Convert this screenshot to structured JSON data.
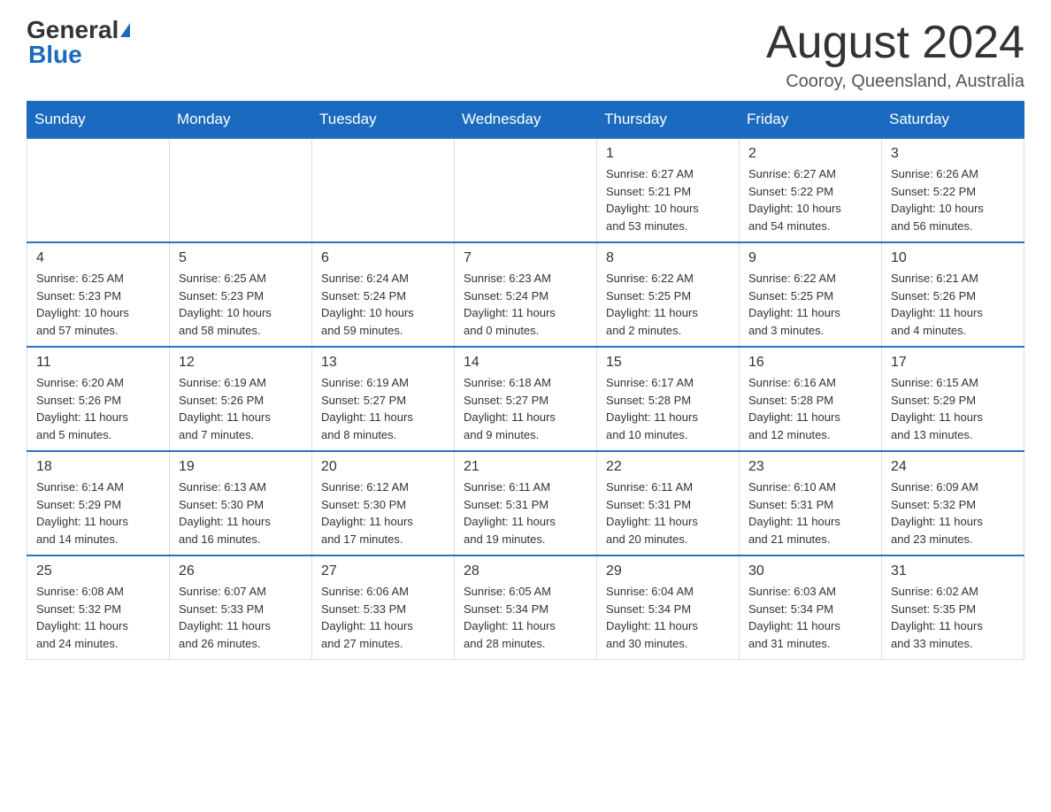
{
  "header": {
    "logo_general": "General",
    "logo_blue": "Blue",
    "month_title": "August 2024",
    "location": "Cooroy, Queensland, Australia"
  },
  "days_of_week": [
    "Sunday",
    "Monday",
    "Tuesday",
    "Wednesday",
    "Thursday",
    "Friday",
    "Saturday"
  ],
  "weeks": [
    [
      {
        "day": "",
        "info": ""
      },
      {
        "day": "",
        "info": ""
      },
      {
        "day": "",
        "info": ""
      },
      {
        "day": "",
        "info": ""
      },
      {
        "day": "1",
        "info": "Sunrise: 6:27 AM\nSunset: 5:21 PM\nDaylight: 10 hours\nand 53 minutes."
      },
      {
        "day": "2",
        "info": "Sunrise: 6:27 AM\nSunset: 5:22 PM\nDaylight: 10 hours\nand 54 minutes."
      },
      {
        "day": "3",
        "info": "Sunrise: 6:26 AM\nSunset: 5:22 PM\nDaylight: 10 hours\nand 56 minutes."
      }
    ],
    [
      {
        "day": "4",
        "info": "Sunrise: 6:25 AM\nSunset: 5:23 PM\nDaylight: 10 hours\nand 57 minutes."
      },
      {
        "day": "5",
        "info": "Sunrise: 6:25 AM\nSunset: 5:23 PM\nDaylight: 10 hours\nand 58 minutes."
      },
      {
        "day": "6",
        "info": "Sunrise: 6:24 AM\nSunset: 5:24 PM\nDaylight: 10 hours\nand 59 minutes."
      },
      {
        "day": "7",
        "info": "Sunrise: 6:23 AM\nSunset: 5:24 PM\nDaylight: 11 hours\nand 0 minutes."
      },
      {
        "day": "8",
        "info": "Sunrise: 6:22 AM\nSunset: 5:25 PM\nDaylight: 11 hours\nand 2 minutes."
      },
      {
        "day": "9",
        "info": "Sunrise: 6:22 AM\nSunset: 5:25 PM\nDaylight: 11 hours\nand 3 minutes."
      },
      {
        "day": "10",
        "info": "Sunrise: 6:21 AM\nSunset: 5:26 PM\nDaylight: 11 hours\nand 4 minutes."
      }
    ],
    [
      {
        "day": "11",
        "info": "Sunrise: 6:20 AM\nSunset: 5:26 PM\nDaylight: 11 hours\nand 5 minutes."
      },
      {
        "day": "12",
        "info": "Sunrise: 6:19 AM\nSunset: 5:26 PM\nDaylight: 11 hours\nand 7 minutes."
      },
      {
        "day": "13",
        "info": "Sunrise: 6:19 AM\nSunset: 5:27 PM\nDaylight: 11 hours\nand 8 minutes."
      },
      {
        "day": "14",
        "info": "Sunrise: 6:18 AM\nSunset: 5:27 PM\nDaylight: 11 hours\nand 9 minutes."
      },
      {
        "day": "15",
        "info": "Sunrise: 6:17 AM\nSunset: 5:28 PM\nDaylight: 11 hours\nand 10 minutes."
      },
      {
        "day": "16",
        "info": "Sunrise: 6:16 AM\nSunset: 5:28 PM\nDaylight: 11 hours\nand 12 minutes."
      },
      {
        "day": "17",
        "info": "Sunrise: 6:15 AM\nSunset: 5:29 PM\nDaylight: 11 hours\nand 13 minutes."
      }
    ],
    [
      {
        "day": "18",
        "info": "Sunrise: 6:14 AM\nSunset: 5:29 PM\nDaylight: 11 hours\nand 14 minutes."
      },
      {
        "day": "19",
        "info": "Sunrise: 6:13 AM\nSunset: 5:30 PM\nDaylight: 11 hours\nand 16 minutes."
      },
      {
        "day": "20",
        "info": "Sunrise: 6:12 AM\nSunset: 5:30 PM\nDaylight: 11 hours\nand 17 minutes."
      },
      {
        "day": "21",
        "info": "Sunrise: 6:11 AM\nSunset: 5:31 PM\nDaylight: 11 hours\nand 19 minutes."
      },
      {
        "day": "22",
        "info": "Sunrise: 6:11 AM\nSunset: 5:31 PM\nDaylight: 11 hours\nand 20 minutes."
      },
      {
        "day": "23",
        "info": "Sunrise: 6:10 AM\nSunset: 5:31 PM\nDaylight: 11 hours\nand 21 minutes."
      },
      {
        "day": "24",
        "info": "Sunrise: 6:09 AM\nSunset: 5:32 PM\nDaylight: 11 hours\nand 23 minutes."
      }
    ],
    [
      {
        "day": "25",
        "info": "Sunrise: 6:08 AM\nSunset: 5:32 PM\nDaylight: 11 hours\nand 24 minutes."
      },
      {
        "day": "26",
        "info": "Sunrise: 6:07 AM\nSunset: 5:33 PM\nDaylight: 11 hours\nand 26 minutes."
      },
      {
        "day": "27",
        "info": "Sunrise: 6:06 AM\nSunset: 5:33 PM\nDaylight: 11 hours\nand 27 minutes."
      },
      {
        "day": "28",
        "info": "Sunrise: 6:05 AM\nSunset: 5:34 PM\nDaylight: 11 hours\nand 28 minutes."
      },
      {
        "day": "29",
        "info": "Sunrise: 6:04 AM\nSunset: 5:34 PM\nDaylight: 11 hours\nand 30 minutes."
      },
      {
        "day": "30",
        "info": "Sunrise: 6:03 AM\nSunset: 5:34 PM\nDaylight: 11 hours\nand 31 minutes."
      },
      {
        "day": "31",
        "info": "Sunrise: 6:02 AM\nSunset: 5:35 PM\nDaylight: 11 hours\nand 33 minutes."
      }
    ]
  ]
}
